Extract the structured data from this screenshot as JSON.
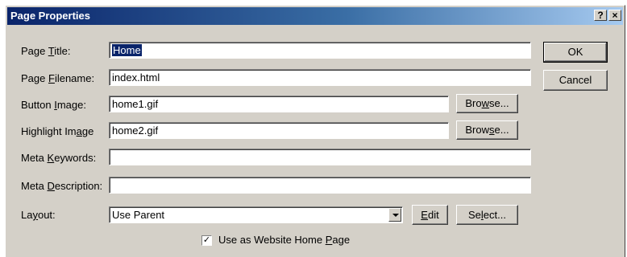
{
  "window": {
    "title": "Page Properties",
    "help_label": "?",
    "close_label": "×"
  },
  "labels": {
    "page_title": [
      "Page ",
      "T",
      "itle:"
    ],
    "page_filename": [
      "Page ",
      "F",
      "ilename:"
    ],
    "button_image": [
      "Button ",
      "I",
      "mage:"
    ],
    "highlight_image": [
      "Highlight Im",
      "a",
      "ge"
    ],
    "meta_keywords": [
      "Meta ",
      "K",
      "eywords:"
    ],
    "meta_description": [
      "Meta ",
      "D",
      "escription:"
    ],
    "layout": [
      "La",
      "y",
      "out:"
    ]
  },
  "fields": {
    "page_title": "Home",
    "page_filename": "index.html",
    "button_image": "home1.gif",
    "highlight_image": "home2.gif",
    "meta_keywords": "",
    "meta_description": "",
    "layout": "Use Parent"
  },
  "buttons": {
    "ok": "OK",
    "cancel": "Cancel",
    "browse1": [
      "Bro",
      "w",
      "se..."
    ],
    "browse2": [
      "Brow",
      "s",
      "e..."
    ],
    "edit": [
      "",
      "E",
      "dit"
    ],
    "select": [
      "Se",
      "l",
      "ect..."
    ]
  },
  "home_checkbox": {
    "checked": true,
    "mark": "✓",
    "label": [
      "Use as Website Home ",
      "P",
      "age"
    ]
  }
}
